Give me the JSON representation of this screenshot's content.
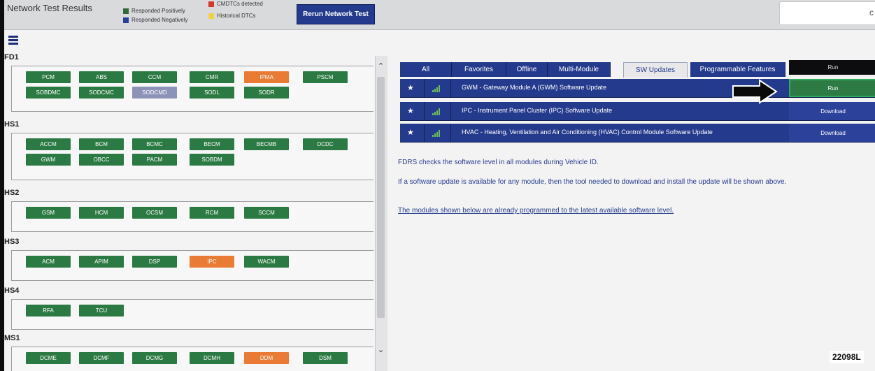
{
  "header": {
    "title": "Network Test Results",
    "legend": [
      {
        "label": "Responded Positively",
        "color": "#2c6b3a"
      },
      {
        "label": "Responded Negatively",
        "color": "#283e9b"
      },
      {
        "label": "CMDTCs detected",
        "color": "#d9362b"
      },
      {
        "label": "Historical DTCs",
        "color": "#f0d23c"
      }
    ],
    "rerun_label": "Rerun Network Test",
    "search_glyph": "c"
  },
  "buses": [
    {
      "name": "FD1",
      "modules": [
        {
          "label": "PCM",
          "status": "green"
        },
        {
          "label": "ABS",
          "status": "green"
        },
        {
          "label": "CCM",
          "status": "green"
        },
        {
          "label": "CMR",
          "status": "green"
        },
        {
          "label": "IPMA",
          "status": "orange"
        },
        {
          "label": "PSCM",
          "status": "green"
        },
        {
          "label": "SOBDMC",
          "status": "green"
        },
        {
          "label": "SODCMC",
          "status": "green"
        },
        {
          "label": "SODCMD",
          "status": "gray"
        },
        {
          "label": "SODL",
          "status": "green"
        },
        {
          "label": "SODR",
          "status": "green"
        }
      ]
    },
    {
      "name": "HS1",
      "modules": [
        {
          "label": "ACCM",
          "status": "green"
        },
        {
          "label": "BCM",
          "status": "green"
        },
        {
          "label": "BCMC",
          "status": "green"
        },
        {
          "label": "BECM",
          "status": "green"
        },
        {
          "label": "BECMB",
          "status": "green"
        },
        {
          "label": "DCDC",
          "status": "green"
        },
        {
          "label": "GWM",
          "status": "green"
        },
        {
          "label": "OBCC",
          "status": "green"
        },
        {
          "label": "PACM",
          "status": "green"
        },
        {
          "label": "SOBDM",
          "status": "green"
        }
      ]
    },
    {
      "name": "HS2",
      "modules": [
        {
          "label": "GSM",
          "status": "green"
        },
        {
          "label": "HCM",
          "status": "green"
        },
        {
          "label": "OCSM",
          "status": "green"
        },
        {
          "label": "RCM",
          "status": "green"
        },
        {
          "label": "SCCM",
          "status": "green"
        }
      ]
    },
    {
      "name": "HS3",
      "modules": [
        {
          "label": "ACM",
          "status": "green"
        },
        {
          "label": "APIM",
          "status": "green"
        },
        {
          "label": "DSP",
          "status": "green"
        },
        {
          "label": "IPC",
          "status": "orange"
        },
        {
          "label": "WACM",
          "status": "green"
        }
      ]
    },
    {
      "name": "HS4",
      "modules": [
        {
          "label": "RFA",
          "status": "green"
        },
        {
          "label": "TCU",
          "status": "green"
        }
      ]
    },
    {
      "name": "MS1",
      "modules": [
        {
          "label": "DCME",
          "status": "green"
        },
        {
          "label": "DCMF",
          "status": "green"
        },
        {
          "label": "DCMG",
          "status": "green"
        },
        {
          "label": "DCMH",
          "status": "green"
        },
        {
          "label": "DDM",
          "status": "orange"
        },
        {
          "label": "DSM",
          "status": "green"
        }
      ]
    }
  ],
  "tabs": [
    {
      "label": "All"
    },
    {
      "label": "Favorites"
    },
    {
      "label": "Offline"
    },
    {
      "label": "Multi-Module"
    },
    {
      "label": "SW Updates",
      "active": true
    },
    {
      "label": "Programmable Features"
    }
  ],
  "run_header": "Run",
  "updates": [
    {
      "star": "★",
      "description": "GWM - Gateway Module A (GWM) Software Update",
      "action": "Run"
    },
    {
      "star": "★",
      "description": "IPC - Instrument Panel Cluster (IPC) Software Update",
      "action": "Download"
    },
    {
      "star": "★",
      "description": "HVAC - Heating, Ventilation and Air Conditioning (HVAC) Control Module Software Update",
      "action": "Download"
    }
  ],
  "info": {
    "line1": "FDRS checks the software level in all modules during Vehicle ID.",
    "line2": "If a software update is available for any module, then the tool needed to download and install the update will be shown above.",
    "line3": "The modules shown below are already programmed to the latest available software level."
  },
  "reference": "22098L"
}
